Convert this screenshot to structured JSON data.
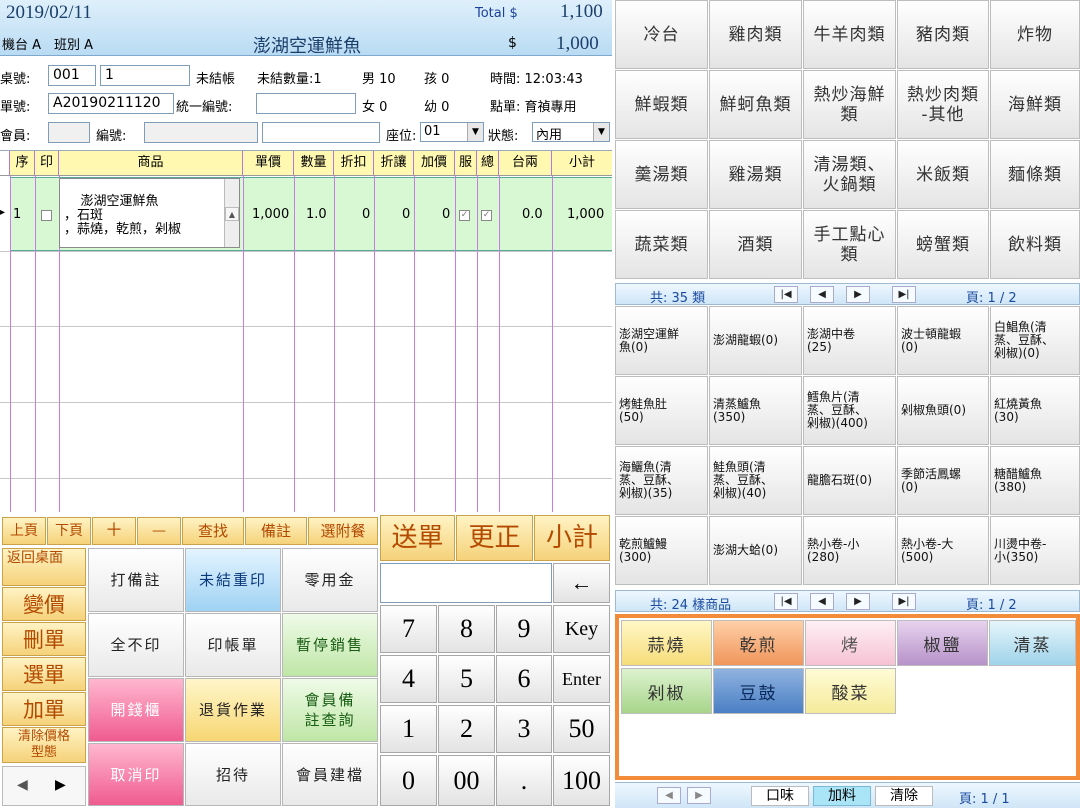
{
  "header": {
    "date": "2019/02/11",
    "total_label": "Total $",
    "total_value": "1,100",
    "machine_shift": "機台 A　班別 A",
    "product_title": "澎湖空運鮮魚",
    "dollar": "$",
    "amount": "1,000"
  },
  "order": {
    "table_label": "桌號:",
    "table_no": "001",
    "guests_box": "1",
    "unsettled_label": "未結帳",
    "unsettled_count": "未結數量:1",
    "male": "男 10",
    "child": "孩 0",
    "time": "時間: 12:03:43",
    "bill_label": "單號:",
    "bill_no": "A20190211120",
    "tax_id_label": "統一編號:",
    "female": "女 0",
    "infant": "幼 0",
    "order_by": "點單: 育禎專用",
    "member_label": "會員:",
    "member_no_label": "編號:",
    "seat_label": "座位:",
    "seat_value": "01",
    "status_label": "狀態:",
    "status_value": "內用"
  },
  "grid": {
    "columns": [
      "序",
      "印",
      "商品",
      "單價",
      "數量",
      "折扣",
      "折讓",
      "加價",
      "服",
      "總",
      "台兩",
      "小計"
    ],
    "row": {
      "seq": "1",
      "memo": "澎湖空運鮮魚\n，石斑\n，蒜燒，乾煎，剁椒",
      "price": "1,000",
      "qty": "1.0",
      "discount": "0",
      "allowance": "0",
      "surcharge": "0",
      "service_checked": true,
      "total_checked": true,
      "tael": "0.0",
      "subtotal": "1,000"
    }
  },
  "toolbar": [
    "上頁",
    "下頁",
    "＋",
    "—",
    "查找",
    "備註",
    "選附餐"
  ],
  "big_actions": {
    "send": "送單",
    "correct": "更正",
    "subtotal": "小計"
  },
  "side_actions": {
    "back": "返回桌面",
    "change_price": "變價",
    "delete": "刪單",
    "select": "選單",
    "add": "加單",
    "clear_price": "清除價格\n型態"
  },
  "functions": [
    "打備註",
    "未結重印",
    "零用金",
    "全不印",
    "印帳單",
    "暫停銷售",
    "開錢櫃",
    "退貨作業",
    "會員備\n註查詢",
    "取消印",
    "招待",
    "會員建檔"
  ],
  "keypad": {
    "backspace": "←",
    "rows": [
      [
        "7",
        "8",
        "9",
        "Key"
      ],
      [
        "4",
        "5",
        "6",
        "Enter"
      ],
      [
        "1",
        "2",
        "3",
        "50"
      ],
      [
        "0",
        "00",
        ".",
        "100"
      ]
    ]
  },
  "categories": [
    "冷台",
    "雞肉類",
    "牛羊肉類",
    "豬肉類",
    "炸物",
    "鮮蝦類",
    "鮮蚵魚類",
    "熱炒海鮮\n類",
    "熱炒肉類\n-其他",
    "海鮮類",
    "羹湯類",
    "雞湯類",
    "清湯類、\n火鍋類",
    "米飯類",
    "麵條類",
    "蔬菜類",
    "酒類",
    "手工點心\n類",
    "螃蟹類",
    "飲料類"
  ],
  "category_pager": {
    "count": "共: 35 類",
    "page": "頁: 1 / 2"
  },
  "items": [
    "澎湖空運鮮\n魚(0)",
    "澎湖龍蝦(0)",
    "澎湖中卷\n(25)",
    "波士頓龍蝦\n(0)",
    "白鯧魚(清\n蒸、豆酥、\n剁椒)(0)",
    "烤鮭魚肚\n(50)",
    "清蒸鱸魚\n(350)",
    "鱈魚片(清\n蒸、豆酥、\n剁椒)(400)",
    "剁椒魚頭(0)",
    "紅燒黃魚\n(30)",
    "海鱺魚(清\n蒸、豆酥、\n剁椒)(35)",
    "鮭魚頭(清\n蒸、豆酥、\n剁椒)(40)",
    "龍膽石斑(0)",
    "季節活鳳螺\n(0)",
    "糖醋鱸魚\n(380)",
    "乾煎鱸鰻\n(300)",
    "澎湖大蛤(0)",
    "熱小卷-小\n(280)",
    "熱小卷-大\n(500)",
    "川燙中卷-\n小(350)"
  ],
  "item_pager": {
    "count": "共: 24 樣商品",
    "page": "頁: 1 / 2"
  },
  "options": [
    "蒜燒",
    "乾煎",
    "烤",
    "椒鹽",
    "清蒸",
    "剁椒",
    "豆鼓",
    "酸菜"
  ],
  "option_tabs": {
    "flavor": "口味",
    "add": "加料",
    "clear": "清除",
    "page": "頁: 1 / 1"
  },
  "colors": {
    "highlight_border": "#f28c3a",
    "selected_row": "#d8f7d3",
    "header_bg": "#cfe6f7"
  }
}
